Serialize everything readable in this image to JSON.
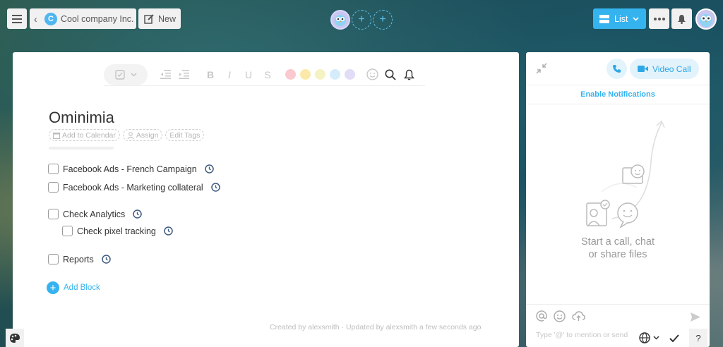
{
  "topbar": {
    "company_initial": "C",
    "company_name": "Cool company Inc.",
    "new_label": "New",
    "view_label": "List"
  },
  "colors": {
    "accent": "#35b3ef",
    "swatches": [
      "#f9c9cf",
      "#fbe9a9",
      "#f5f2c3",
      "#d5ecfb",
      "#e1dcf7"
    ]
  },
  "toolbar": {
    "bold": "B",
    "italic": "I",
    "underline": "U",
    "strike": "S"
  },
  "doc": {
    "title": "Ominimia",
    "meta": {
      "calendar": "Add to Calendar",
      "assign": "Assign",
      "tags": "Edit Tags"
    },
    "tasks": [
      {
        "label": "Facebook Ads - French Campaign",
        "checked": false,
        "indent": 0
      },
      {
        "label": "Facebook Ads - Marketing collateral",
        "checked": false,
        "indent": 0
      },
      {
        "label": "Check Analytics",
        "checked": false,
        "indent": 0
      },
      {
        "label": "Check pixel tracking",
        "checked": false,
        "indent": 1
      },
      {
        "label": "Reports",
        "checked": false,
        "indent": 0
      }
    ],
    "add_block": "Add Block",
    "footer": "Created by alexsmith · Updated by alexsmith a few seconds ago"
  },
  "chat": {
    "video_call": "Video Call",
    "enable_notifications": "Enable Notifications",
    "empty_line1": "Start a call, chat",
    "empty_line2": "or share files",
    "composer_placeholder": "Type '@' to mention or send"
  }
}
